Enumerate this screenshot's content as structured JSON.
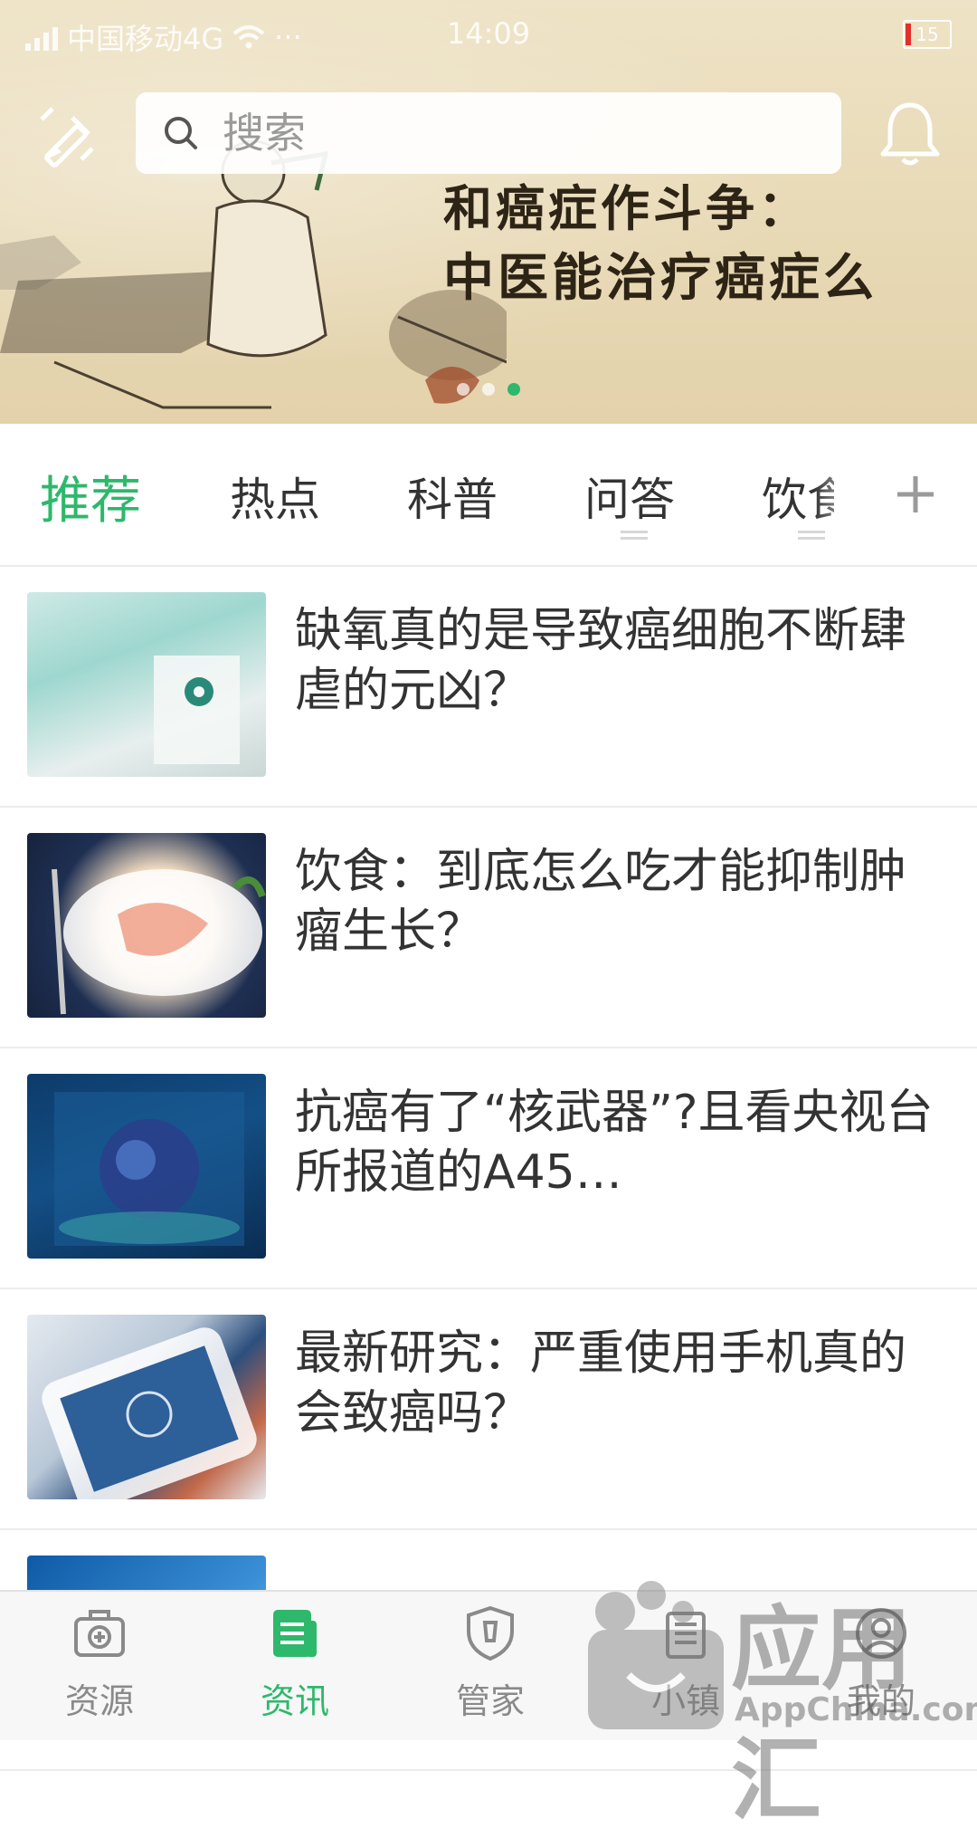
{
  "status_bar": {
    "carrier": "中国移动4G",
    "extra": "···",
    "time": "14:09",
    "battery": "15"
  },
  "header": {
    "search_placeholder": "搜索",
    "icons": {
      "edit": "edit-icon",
      "search": "search-icon",
      "notifications": "bell-icon"
    }
  },
  "banner": {
    "title_line1": "和癌症作斗争：",
    "title_line2": "中医能治疗癌症么",
    "slide_count": 3,
    "active_slide": 3
  },
  "tabs": {
    "items": [
      {
        "label": "推荐",
        "active": true
      },
      {
        "label": "热点",
        "active": false
      },
      {
        "label": "科普",
        "active": false
      },
      {
        "label": "问答",
        "active": false
      },
      {
        "label": "饮食",
        "active": false
      }
    ],
    "add_icon": "plus-icon"
  },
  "articles": [
    {
      "title": "缺氧真的是导致癌细胞不断肆虐的元凶？"
    },
    {
      "title": "饮食：到底怎么吃才能抑制肿瘤生长？"
    },
    {
      "title": "抗癌有了“核武器”?且看央视台所报道的A45…"
    },
    {
      "title": "最新研究：严重使用手机真的会致癌吗？"
    },
    {
      "title": ""
    }
  ],
  "bottom_nav": {
    "items": [
      {
        "label": "资源",
        "icon": "medkit-icon",
        "active": false
      },
      {
        "label": "资讯",
        "icon": "news-icon",
        "active": true
      },
      {
        "label": "管家",
        "icon": "shield-icon",
        "active": false
      },
      {
        "label": "小镇",
        "icon": "building-icon",
        "active": false
      },
      {
        "label": "我的",
        "icon": "profile-icon",
        "active": false
      }
    ]
  },
  "watermark": {
    "text": "应用汇",
    "sub": "AppChina.com"
  },
  "colors": {
    "accent": "#2db86b",
    "text": "#333333",
    "muted": "#8a8a8a",
    "divider": "#ececec"
  }
}
